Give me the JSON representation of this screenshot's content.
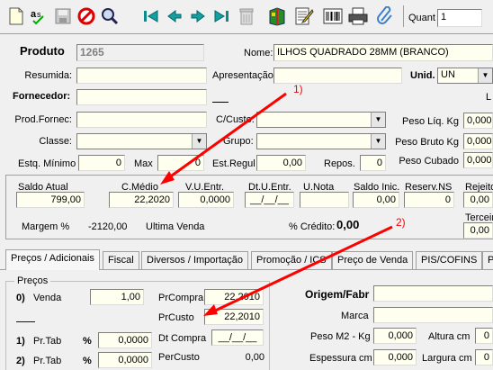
{
  "toolbar": {
    "icons": [
      "new-icon",
      "spell-icon",
      "save-icon",
      "cancel-icon",
      "search-icon",
      "first-icon",
      "prev-icon",
      "next-icon",
      "last-icon",
      "delete-icon",
      "book-icon",
      "edit-icon",
      "barcode-icon",
      "print-icon",
      "attach-icon"
    ],
    "quant_label": "Quant",
    "quant_value": "1"
  },
  "header": {
    "produto_label": "Produto",
    "produto_code": "1265",
    "nome_label": "Nome:",
    "nome_value": "ILHOS QUADRADO 28MM (BRANCO)",
    "resumida_label": "Resumida:",
    "apresentacao_label": "Apresentação",
    "unid_label": "Unid.",
    "unid_value": "UN",
    "fornecedor_label": "Fornecedor:",
    "prodfornec_label": "Prod.Fornec:",
    "ccusto_label": "C/Custo:",
    "classe_label": "Classe:",
    "grupo_label": "Grupo:",
    "estq_min_label": "Estq. Mínimo",
    "estq_min_value": "0",
    "max_label": "Max",
    "max_value": "0",
    "est_regul_label": "Est.Regul",
    "est_regul_value": "0,00",
    "repos_label": "Repos.",
    "repos_value": "0",
    "peso_liq_label": "Peso Líq. Kg",
    "peso_liq_value": "0,000",
    "peso_bruto_label": "Peso Bruto Kg",
    "peso_bruto_value": "0,000",
    "peso_cubado_label": "Peso Cubado",
    "peso_cubado_value": "0,000",
    "l_label": "L"
  },
  "summary": {
    "saldo_atual_label": "Saldo Atual",
    "saldo_atual_value": "799,00",
    "cmedio_label": "C.Médio",
    "cmedio_value": "22,2020",
    "vu_entr_label": "V.U.Entr.",
    "vu_entr_value": "0,0000",
    "dt_u_entr_label": "Dt.U.Entr.",
    "dt_u_entr_value": "__/__/__",
    "u_nota_label": "U.Nota",
    "saldo_inic_label": "Saldo Inic.",
    "saldo_inic_value": "0,00",
    "reserv_ns_label": "Reserv.NS",
    "reserv_ns_value": "0",
    "rejeito_label": "Rejeito",
    "rejeito_value": "0,00",
    "terceir_label": "Terceir",
    "terceir_value": "0,00",
    "margem_label": "Margem  %",
    "margem_value": "-2120,00",
    "ultima_venda_label": "Ultima Venda",
    "credito_label": "% Crédito:",
    "credito_value": "0,00"
  },
  "annotations": {
    "one": "1)",
    "two": "2)"
  },
  "tabs": [
    "Preços / Adicionais",
    "Fiscal",
    "Diversos / Importação",
    "Promoção / ICS",
    "Preço de Venda",
    "PIS/COFINS",
    "P"
  ],
  "precos": {
    "section_label": "Preços",
    "venda_num": "0)",
    "venda_label": "Venda",
    "venda_value": "1,00",
    "prcompra_label": "PrCompra",
    "prcompra_value": "22,2010",
    "prcusto_label": "PrCusto",
    "prcusto_value": "22,2010",
    "prtab1_num": "1)",
    "prtab1_label": "Pr.Tab",
    "prtab1_pct": "%",
    "prtab1_value": "0,0000",
    "dtcompra_label": "Dt Compra",
    "dtcompra_value": "__/__/__",
    "prtab2_num": "2)",
    "prtab2_label": "Pr.Tab",
    "prtab2_pct": "%",
    "prtab2_value": "0,0000",
    "percusto_label": "PerCusto",
    "percusto_value": "0,00"
  },
  "origem": {
    "origem_label": "Origem/Fabr",
    "marca_label": "Marca",
    "peso_m2_label": "Peso M2 - Kg",
    "peso_m2_value": "0,000",
    "altura_label": "Altura cm",
    "altura_value": "0",
    "espessura_label": "Espessura cm",
    "espessura_value": "0,000",
    "largura_label": "Largura cm",
    "largura_value": "0"
  },
  "colors": {
    "field_bg": "#fffff0",
    "arrow": "#ff0000",
    "link_blue": "#0000cc"
  }
}
